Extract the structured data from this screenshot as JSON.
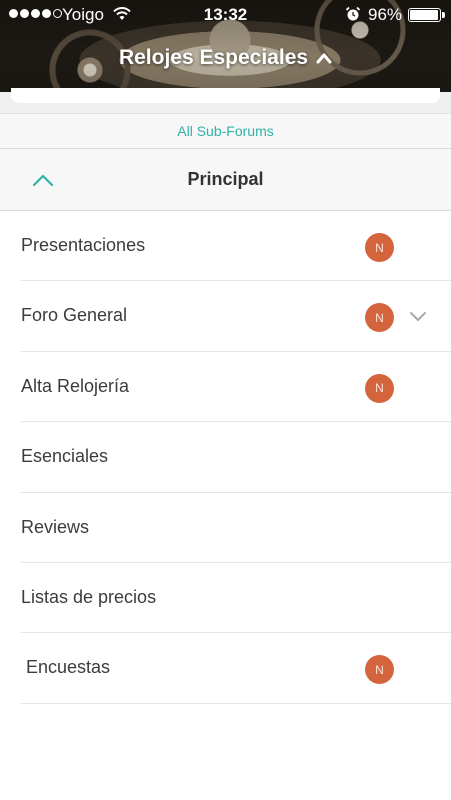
{
  "status_bar": {
    "carrier": "Yoigo",
    "time": "13:32",
    "battery": "96%",
    "battery_level": 0.96
  },
  "header": {
    "title": "Relojes Especiales",
    "title_icon": "chevron-up-icon"
  },
  "subforums_link": "All Sub-Forums",
  "section": {
    "title": "Principal",
    "toggle_icon": "chevron-up-icon"
  },
  "forums": [
    {
      "label": "Presentaciones",
      "new": true,
      "badge": "N",
      "expand": false
    },
    {
      "label": "Foro General",
      "new": true,
      "badge": "N",
      "expand": true
    },
    {
      "label": "Alta Relojería",
      "new": true,
      "badge": "N",
      "expand": false
    },
    {
      "label": "Esenciales",
      "new": false,
      "badge": "",
      "expand": false
    },
    {
      "label": "Reviews",
      "new": false,
      "badge": "",
      "expand": false
    },
    {
      "label": "Listas de precios",
      "new": false,
      "badge": "",
      "expand": false
    },
    {
      "label": "Encuestas",
      "new": true,
      "badge": "N",
      "expand": false
    }
  ],
  "colors": {
    "accent": "#2fb2a8",
    "badge": "#d4643b",
    "text": "#3c3c3c"
  }
}
